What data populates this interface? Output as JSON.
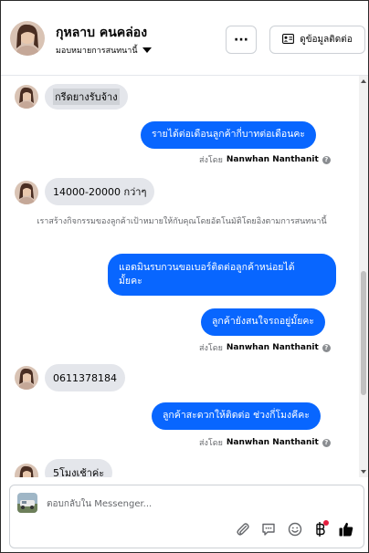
{
  "header": {
    "contact_name": "กุหลาบ คนคล่อง",
    "assign_label": "มอบหมายการสนทนานี้",
    "more_label": "···",
    "view_contact_label": "ดูข้อมูลติดต่อ"
  },
  "messages": [
    {
      "direction": "in",
      "text": "กรีดยางรับจ้าง"
    },
    {
      "direction": "out",
      "text": "รายได้ต่อเดือนลูกค้ากี่บาทต่อเดือนคะ"
    },
    {
      "direction": "meta",
      "prefix": "ส่งโดย",
      "name": "Nanwhan Nanthanit"
    },
    {
      "direction": "in",
      "text": "14000-20000 กว่าๆ"
    },
    {
      "direction": "system",
      "text": "เราสร้างกิจกรรมของลูกค้าเป้าหมายให้กับคุณโดยอัตโนมัติโดยอิงตามการสนทนานี้"
    },
    {
      "direction": "out",
      "line1": "แอดมินรบกวนขอเบอร์ติดต่อลูกค้าหน่อยได้",
      "line2": "มั้ยคะ"
    },
    {
      "direction": "out",
      "text": "ลูกค้ายังสนใจรถอยู่มั้ยคะ"
    },
    {
      "direction": "meta",
      "prefix": "ส่งโดย",
      "name": "Nanwhan Nanthanit"
    },
    {
      "direction": "in",
      "text": "0611378184"
    },
    {
      "direction": "out",
      "text": "ลูกค้าสะดวกให้ติดต่อ ช่วงกี่โมงคีคะ"
    },
    {
      "direction": "meta",
      "prefix": "ส่งโดย",
      "name": "Nanwhan Nanthanit"
    },
    {
      "direction": "in",
      "text": "5โมงเช้าค่ะ"
    }
  ],
  "composer": {
    "placeholder": "ตอบกลับใน Messenger..."
  },
  "icons": {
    "attach": "paperclip-icon",
    "saved_reply": "chat-bubble-icon",
    "emoji": "smiley-icon",
    "currency": "baht-icon",
    "like": "thumbs-up-icon"
  },
  "colors": {
    "outgoing_bubble": "#0866ff",
    "incoming_bubble": "#e4e6eb",
    "notification_dot": "#e41e3f"
  }
}
